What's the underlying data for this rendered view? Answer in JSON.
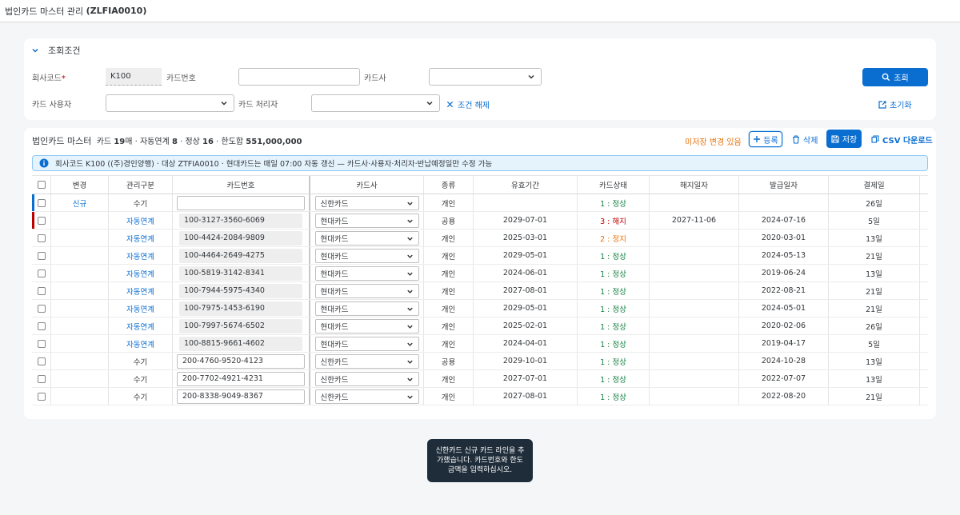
{
  "app": {
    "title": "법인카드 마스터 관리",
    "code": "(ZLFIA0010)"
  },
  "filter": {
    "title": "조회조건",
    "company_label": "회사코드",
    "required_mark": "*",
    "company_value": "K100",
    "card_no_label": "카드번호",
    "card_no_value": "",
    "issuer_label": "카드사",
    "issuer_value": "",
    "user_label": "카드 사용자",
    "user_value": "",
    "handler_label": "카드 처리자",
    "handler_value": "",
    "clear_label": "조건 해제",
    "search_label": "조회",
    "reset_label": "초기화"
  },
  "master": {
    "title": "법인카드 마스터",
    "s1": "카드",
    "n1": "19",
    "s2": "매 · 자동연계",
    "n2": "8",
    "s3": " · 정상",
    "n3": "16",
    "s4": " · 한도합",
    "n4": "551,000,000",
    "unsaved": "미저장 변경 있음",
    "add_label": "등록",
    "delete_label": "삭제",
    "save_label": "저장",
    "csv_label": "CSV 다운로드",
    "info": "회사코드 K100 ((주)경인양행) · 대상 ZTFIA0010 · 현대카드는 매일 07:00 자동 갱신 — 카드사·사용자·처리자·반납예정일만 수정 가능"
  },
  "columns": [
    "변경",
    "관리구분",
    "카드번호",
    "카드사",
    "종류",
    "유효기간",
    "카드상태",
    "해지일자",
    "발급일자",
    "결제일"
  ],
  "colors": {
    "accent": "#0a6ed1",
    "new_marker": "#0a6ed1",
    "cancel_marker": "#bb0000",
    "normal": "#107e3e",
    "cancelled": "#bb0000",
    "suspended": "#e9730c"
  },
  "rows": [
    {
      "change": "신규",
      "kind": "수기",
      "card": "",
      "card_mode": "edit",
      "issuer": "신한카드",
      "type": "개인",
      "valid": "",
      "status": "1 : 정상",
      "st": "normal",
      "cancel": "",
      "issue": "",
      "pay": "26일",
      "marker": "new"
    },
    {
      "change": "",
      "kind": "자동연계",
      "card": "100-3127-3560-6069",
      "card_mode": "ro",
      "issuer": "현대카드",
      "type": "공용",
      "valid": "2029-07-01",
      "status": "3 : 해지",
      "st": "cancelled",
      "cancel": "2027-11-06",
      "issue": "2024-07-16",
      "pay": "5일",
      "marker": "cancel"
    },
    {
      "change": "",
      "kind": "자동연계",
      "card": "100-4424-2084-9809",
      "card_mode": "ro",
      "issuer": "현대카드",
      "type": "개인",
      "valid": "2025-03-01",
      "status": "2 : 정지",
      "st": "suspended",
      "cancel": "",
      "issue": "2020-03-01",
      "pay": "13일",
      "marker": ""
    },
    {
      "change": "",
      "kind": "자동연계",
      "card": "100-4464-2649-4275",
      "card_mode": "ro",
      "issuer": "현대카드",
      "type": "개인",
      "valid": "2029-05-01",
      "status": "1 : 정상",
      "st": "normal",
      "cancel": "",
      "issue": "2024-05-13",
      "pay": "21일",
      "marker": ""
    },
    {
      "change": "",
      "kind": "자동연계",
      "card": "100-5819-3142-8341",
      "card_mode": "ro",
      "issuer": "현대카드",
      "type": "개인",
      "valid": "2024-06-01",
      "status": "1 : 정상",
      "st": "normal",
      "cancel": "",
      "issue": "2019-06-24",
      "pay": "13일",
      "marker": ""
    },
    {
      "change": "",
      "kind": "자동연계",
      "card": "100-7944-5975-4340",
      "card_mode": "ro",
      "issuer": "현대카드",
      "type": "개인",
      "valid": "2027-08-01",
      "status": "1 : 정상",
      "st": "normal",
      "cancel": "",
      "issue": "2022-08-21",
      "pay": "21일",
      "marker": ""
    },
    {
      "change": "",
      "kind": "자동연계",
      "card": "100-7975-1453-6190",
      "card_mode": "ro",
      "issuer": "현대카드",
      "type": "개인",
      "valid": "2029-05-01",
      "status": "1 : 정상",
      "st": "normal",
      "cancel": "",
      "issue": "2024-05-01",
      "pay": "21일",
      "marker": ""
    },
    {
      "change": "",
      "kind": "자동연계",
      "card": "100-7997-5674-6502",
      "card_mode": "ro",
      "issuer": "현대카드",
      "type": "개인",
      "valid": "2025-02-01",
      "status": "1 : 정상",
      "st": "normal",
      "cancel": "",
      "issue": "2020-02-06",
      "pay": "26일",
      "marker": ""
    },
    {
      "change": "",
      "kind": "자동연계",
      "card": "100-8815-9661-4602",
      "card_mode": "ro",
      "issuer": "현대카드",
      "type": "개인",
      "valid": "2024-04-01",
      "status": "1 : 정상",
      "st": "normal",
      "cancel": "",
      "issue": "2019-04-17",
      "pay": "5일",
      "marker": ""
    },
    {
      "change": "",
      "kind": "수기",
      "card": "200-4760-9520-4123",
      "card_mode": "edit",
      "issuer": "신한카드",
      "type": "공용",
      "valid": "2029-10-01",
      "status": "1 : 정상",
      "st": "normal",
      "cancel": "",
      "issue": "2024-10-28",
      "pay": "13일",
      "marker": ""
    },
    {
      "change": "",
      "kind": "수기",
      "card": "200-7702-4921-4231",
      "card_mode": "edit",
      "issuer": "신한카드",
      "type": "개인",
      "valid": "2027-07-01",
      "status": "1 : 정상",
      "st": "normal",
      "cancel": "",
      "issue": "2022-07-07",
      "pay": "13일",
      "marker": ""
    },
    {
      "change": "",
      "kind": "수기",
      "card": "200-8338-9049-8367",
      "card_mode": "edit",
      "issuer": "신한카드",
      "type": "개인",
      "valid": "2027-08-01",
      "status": "1 : 정상",
      "st": "normal",
      "cancel": "",
      "issue": "2022-08-20",
      "pay": "21일",
      "marker": ""
    }
  ],
  "toast": "신한카드 신규 카드 라인을 추가했습니다. 카드번호와 한도금액을 입력하십시오."
}
